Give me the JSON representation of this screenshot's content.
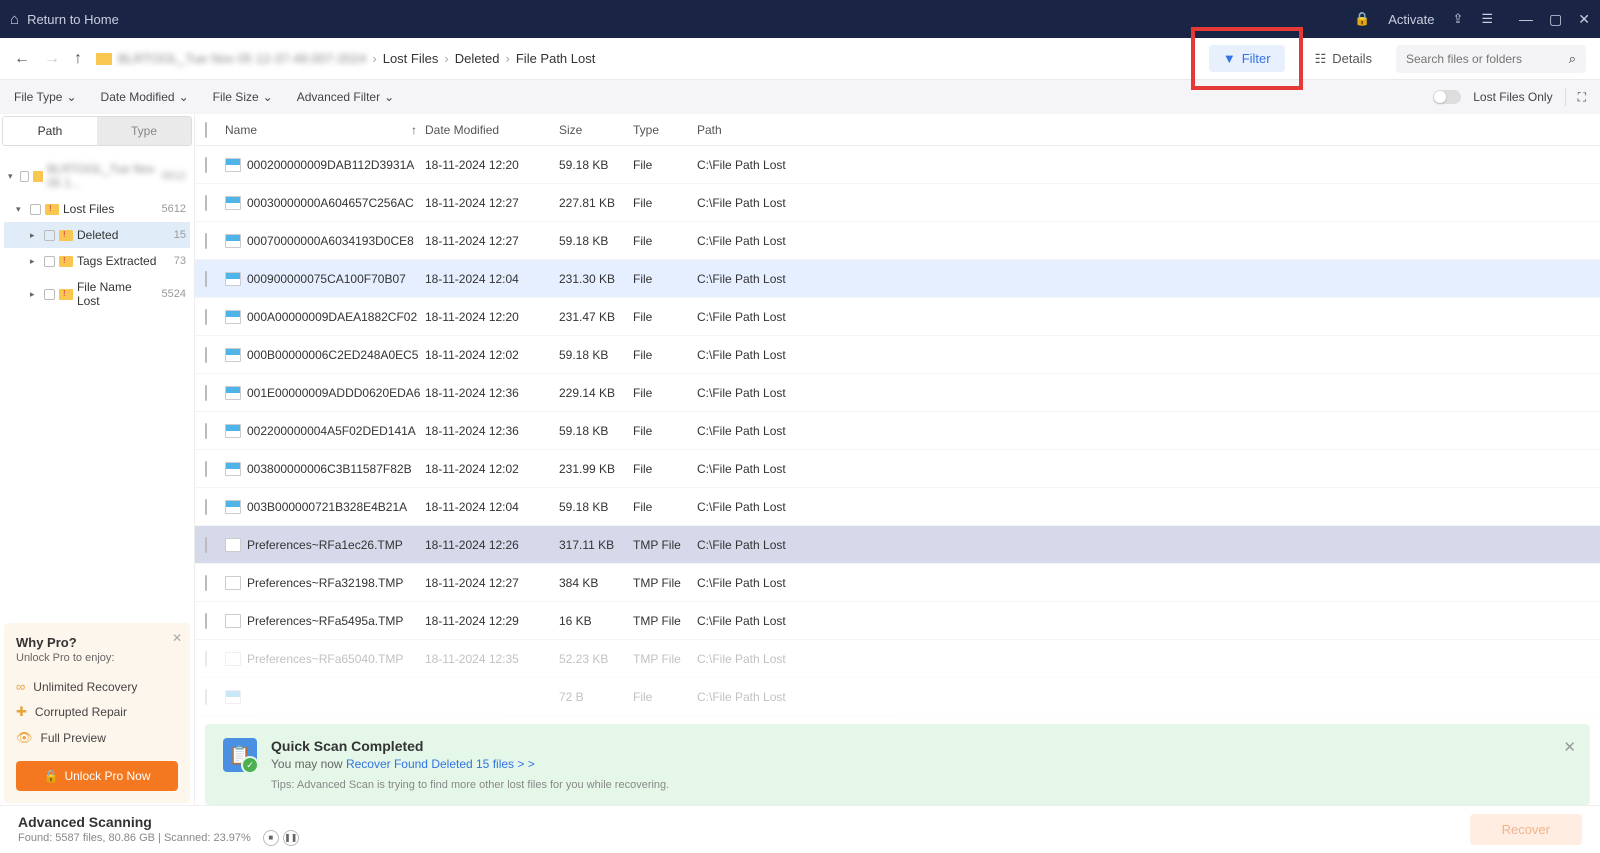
{
  "titlebar": {
    "home": "Return to Home",
    "activate": "Activate"
  },
  "breadcrumb": {
    "root": "BLRTOOL_Tue Nov 05 12-37-49.007-2024",
    "items": [
      "Lost Files",
      "Deleted",
      "File Path Lost"
    ]
  },
  "toolbar": {
    "filter": "Filter",
    "details": "Details",
    "search_placeholder": "Search files or folders"
  },
  "filters": {
    "file_type": "File Type",
    "date_modified": "Date Modified",
    "file_size": "File Size",
    "advanced": "Advanced Filter",
    "lost_only": "Lost Files Only"
  },
  "sidebar": {
    "tab_path": "Path",
    "tab_type": "Type",
    "root_label": "BLRTOOL_Tue Nov 05 1...",
    "root_count": "5612",
    "items": [
      {
        "label": "Lost Files",
        "count": "5612"
      },
      {
        "label": "Deleted",
        "count": "15"
      },
      {
        "label": "Tags Extracted",
        "count": "73"
      },
      {
        "label": "File Name Lost",
        "count": "5524"
      }
    ]
  },
  "columns": {
    "name": "Name",
    "date": "Date Modified",
    "size": "Size",
    "type": "Type",
    "path": "Path"
  },
  "rows": [
    {
      "name": "000200000009DAB112D3931A",
      "date": "18-11-2024 12:20",
      "size": "59.18 KB",
      "type": "File",
      "path": "C:\\File Path Lost",
      "icon": "file"
    },
    {
      "name": "00030000000A604657C256AC",
      "date": "18-11-2024 12:27",
      "size": "227.81 KB",
      "type": "File",
      "path": "C:\\File Path Lost",
      "icon": "file"
    },
    {
      "name": "00070000000A6034193D0CE8",
      "date": "18-11-2024 12:27",
      "size": "59.18 KB",
      "type": "File",
      "path": "C:\\File Path Lost",
      "icon": "file"
    },
    {
      "name": "000900000075CA100F70B07",
      "date": "18-11-2024 12:04",
      "size": "231.30 KB",
      "type": "File",
      "path": "C:\\File Path Lost",
      "icon": "file",
      "sel": 1
    },
    {
      "name": "000A00000009DAEA1882CF02",
      "date": "18-11-2024 12:20",
      "size": "231.47 KB",
      "type": "File",
      "path": "C:\\File Path Lost",
      "icon": "file"
    },
    {
      "name": "000B00000006C2ED248A0EC5",
      "date": "18-11-2024 12:02",
      "size": "59.18 KB",
      "type": "File",
      "path": "C:\\File Path Lost",
      "icon": "file"
    },
    {
      "name": "001E00000009ADDD0620EDA6",
      "date": "18-11-2024 12:36",
      "size": "229.14 KB",
      "type": "File",
      "path": "C:\\File Path Lost",
      "icon": "file"
    },
    {
      "name": "002200000004A5F02DED141A",
      "date": "18-11-2024 12:36",
      "size": "59.18 KB",
      "type": "File",
      "path": "C:\\File Path Lost",
      "icon": "file"
    },
    {
      "name": "003800000006C3B11587F82B",
      "date": "18-11-2024 12:02",
      "size": "231.99 KB",
      "type": "File",
      "path": "C:\\File Path Lost",
      "icon": "file"
    },
    {
      "name": "003B000000721B328E4B21A",
      "date": "18-11-2024 12:04",
      "size": "59.18 KB",
      "type": "File",
      "path": "C:\\File Path Lost",
      "icon": "file"
    },
    {
      "name": "Preferences~RFa1ec26.TMP",
      "date": "18-11-2024 12:26",
      "size": "317.11 KB",
      "type": "TMP File",
      "path": "C:\\File Path Lost",
      "icon": "tmp",
      "sel": 2
    },
    {
      "name": "Preferences~RFa32198.TMP",
      "date": "18-11-2024 12:27",
      "size": "384 KB",
      "type": "TMP File",
      "path": "C:\\File Path Lost",
      "icon": "tmp"
    },
    {
      "name": "Preferences~RFa5495a.TMP",
      "date": "18-11-2024 12:29",
      "size": "16 KB",
      "type": "TMP File",
      "path": "C:\\File Path Lost",
      "icon": "tmp"
    },
    {
      "name": "Preferences~RFa65040.TMP",
      "date": "18-11-2024 12:35",
      "size": "52.23 KB",
      "type": "TMP File",
      "path": "C:\\File Path Lost",
      "icon": "tmp",
      "ghost": true
    },
    {
      "name": "",
      "date": "",
      "size": "72 B",
      "type": "File",
      "path": "C:\\File Path Lost",
      "icon": "file",
      "ghost": true
    }
  ],
  "notification": {
    "title": "Quick Scan Completed",
    "text": "You may now ",
    "link": "Recover Found Deleted 15 files > >",
    "tip": "Tips: Advanced Scan is trying to find more other lost files for you while recovering."
  },
  "status": {
    "title": "Advanced Scanning",
    "detail": "Found: 5587 files, 80.86 GB  |  Scanned: 23.97%",
    "recover": "Recover"
  },
  "promo": {
    "title": "Why Pro?",
    "subtitle": "Unlock Pro to enjoy:",
    "items": [
      "Unlimited Recovery",
      "Corrupted Repair",
      "Full Preview"
    ],
    "button": "Unlock Pro Now"
  }
}
